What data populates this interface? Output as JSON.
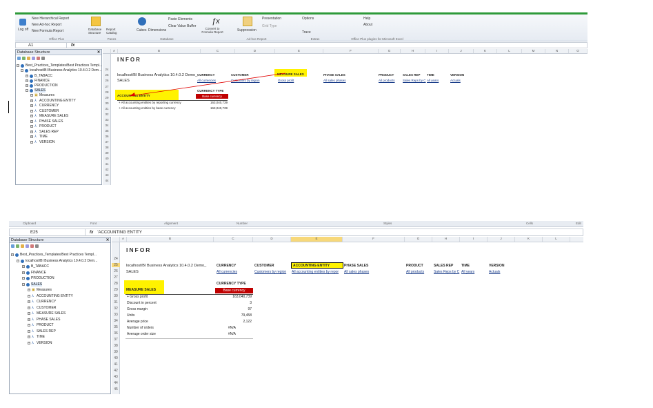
{
  "top": {
    "ribbon": {
      "log_off": "Log off",
      "new_adhoc": "New Hierarchical Report",
      "new_adhoc2": "New Ad-hoc Report",
      "new_formula": "New Formula Report",
      "db_structure": "Database Structure",
      "report_catalog": "Report Catalog",
      "cubes": "Cubes",
      "dimensions": "Dimensions",
      "paste_elements": "Paste Elements",
      "clear_buffer": "Clear Value Buffer",
      "convert": "Convert to Formula Report",
      "suppression": "Suppression",
      "presentation": "Presentation",
      "grid_type": "Grid Type",
      "options": "Options",
      "trace": "Trace",
      "help": "Help",
      "about": "About",
      "groups": [
        "Office Plus",
        "Panes",
        "Database",
        "Ad-hoc Report",
        "Extras",
        "Office Plus plugins for Microsoft Excel"
      ]
    },
    "namebox": "A1",
    "formula": "",
    "pane_title": "Database Structure",
    "tree": [
      "Best_Practices_Templates/Best Practices Templ...",
      "localhost/BI Business Analytics 10.4.0.2 Dem...",
      "B_TABACC",
      "FINANCE",
      "PRODUCTION",
      "SALES",
      "Measures",
      "ACCOUNTING ENTITY",
      "CURRENCY",
      "CUSTOMER",
      "MEASURE SALES",
      "PHASE SALES",
      "PRODUCT",
      "SALES REP",
      "TIME",
      "VERSION"
    ],
    "cols": [
      "A",
      "B",
      "C",
      "D",
      "E",
      "F",
      "G",
      "H",
      "I",
      "J",
      "K",
      "L",
      "M",
      "N",
      "O"
    ],
    "rows": [
      "24",
      "25",
      "26",
      "27",
      "28",
      "29",
      "30",
      "31",
      "32",
      "33",
      "34",
      "35",
      "36",
      "37",
      "38",
      "39",
      "40",
      "41",
      "42",
      "43",
      "44"
    ],
    "logo": "INFOR",
    "server": "localhost/BI Business Analytics 10.4.0.2 Demo_",
    "cube": "SALES",
    "dims": [
      "CURRENCY",
      "CUSTOMER",
      "MEASURE SALES",
      "PHASE SALES",
      "PRODUCT",
      "SALES REP",
      "TIME",
      "VERSION"
    ],
    "vals": [
      "All currencies",
      "Customers by region",
      "Gross profit",
      "All sales phases",
      "All products",
      "Sales Reps by C",
      "All years",
      "Actuals"
    ],
    "curtype": "CURRENCY TYPE",
    "basecur": "Base currency",
    "rowdim": "ACCOUNTING ENTITY",
    "rowlabels": [
      "+ All accounting entities by reporting currency",
      "+ All accounting entities by base currency"
    ],
    "rowvals": [
      "163,040,739",
      "163,040,739"
    ]
  },
  "bottom": {
    "groups": [
      "Clipboard",
      "Font",
      "Alignment",
      "Number",
      "Styles",
      "Cells",
      "Edit"
    ],
    "namebox": "E25",
    "formula": "'ACCOUNTING ENTITY",
    "pane_title": "Database Structure",
    "tree": [
      "Best_Practices_Templates/Best Practices Templ...",
      "localhost/BI Business Analytics 10.4.0.2 Dem...",
      "B_TABACC",
      "FINANCE",
      "PRODUCTION",
      "SALES",
      "Measures",
      "ACCOUNTING ENTITY",
      "CURRENCY",
      "CUSTOMER",
      "MEASURE SALES",
      "PHASE SALES",
      "PRODUCT",
      "SALES REP",
      "TIME",
      "VERSION"
    ],
    "cols": [
      "A",
      "B",
      "C",
      "D",
      "E",
      "F",
      "G",
      "H",
      "I",
      "J",
      "K",
      "L"
    ],
    "rows": [
      "24",
      "25",
      "26",
      "27",
      "28",
      "29",
      "30",
      "31",
      "32",
      "33",
      "34",
      "35",
      "36",
      "37",
      "38",
      "39",
      "40",
      "41",
      "42",
      "43",
      "44",
      "45"
    ],
    "logo": "INFOR",
    "server": "localhost/BI Business Analytics 10.4.0.2 Demo_",
    "cube": "SALES",
    "dims": [
      "CURRENCY",
      "CUSTOMER",
      "ACCOUNTING ENTITY",
      "PHASE SALES",
      "PRODUCT",
      "SALES REP",
      "TIME",
      "VERSION"
    ],
    "vals": [
      "All currencies",
      "Customers by region",
      "All accounting entities by repor",
      "All sales phases",
      "All products",
      "Sales Reps by C",
      "All years",
      "Actuals"
    ],
    "curtype": "CURRENCY TYPE",
    "basecur": "Base currency",
    "rowdim": "MEASURE SALES",
    "rowlabels": [
      "+ Gross profit",
      "Discount in percent",
      "Gross margin",
      "Units",
      "Average price",
      "Number of orders",
      "Average order size"
    ],
    "rowvals": [
      "163,040,739",
      "3",
      "97",
      "79,458",
      "2,122",
      "#N/A",
      "#N/A"
    ]
  },
  "colors": {
    "accent": "#2e9a3a",
    "highlight": "#fff200",
    "red": "#c00000"
  }
}
